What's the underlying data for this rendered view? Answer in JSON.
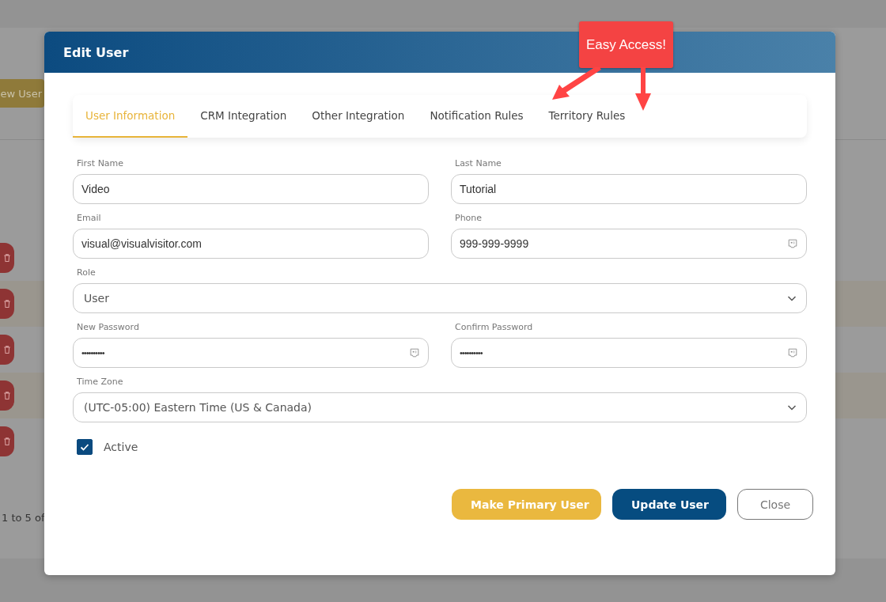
{
  "background": {
    "add_button": "ew User",
    "rows": [
      {
        "highlighted": false
      },
      {
        "highlighted": true
      },
      {
        "highlighted": false
      },
      {
        "highlighted": true
      },
      {
        "highlighted": false
      }
    ],
    "pager_text": "1 to 5 of"
  },
  "dialog": {
    "title": "Edit User",
    "tabs": [
      {
        "label": "User Information",
        "selected": true
      },
      {
        "label": "CRM Integration",
        "selected": false
      },
      {
        "label": "Other Integration",
        "selected": false
      },
      {
        "label": "Notification Rules",
        "selected": false
      },
      {
        "label": "Territory Rules",
        "selected": false
      }
    ],
    "fields": [
      {
        "kind": "text",
        "label": "First Name",
        "value": "Video"
      },
      {
        "kind": "text",
        "label": "Last Name",
        "value": "Tutorial"
      },
      {
        "kind": "text",
        "label": "Email",
        "value": "visual@visualvisitor.com"
      },
      {
        "kind": "phone",
        "label": "Phone",
        "value": "999-999-9999"
      },
      {
        "kind": "select",
        "label": "Role",
        "value": "User"
      },
      {
        "kind": "password",
        "label": "New Password",
        "value": "••••••••••"
      },
      {
        "kind": "password",
        "label": "Confirm Password",
        "value": "••••••••••"
      },
      {
        "kind": "select",
        "label": "Time Zone",
        "value": "(UTC-05:00) Eastern Time (US & Canada)"
      }
    ],
    "active": {
      "label": "Active",
      "checked": true
    },
    "buttons": [
      {
        "kind": "primary-gold",
        "label": "Make Primary User"
      },
      {
        "kind": "primary-blue",
        "label": "Update User"
      },
      {
        "kind": "outline",
        "label": "Close"
      }
    ]
  },
  "callout": {
    "text": "Easy Access!"
  }
}
